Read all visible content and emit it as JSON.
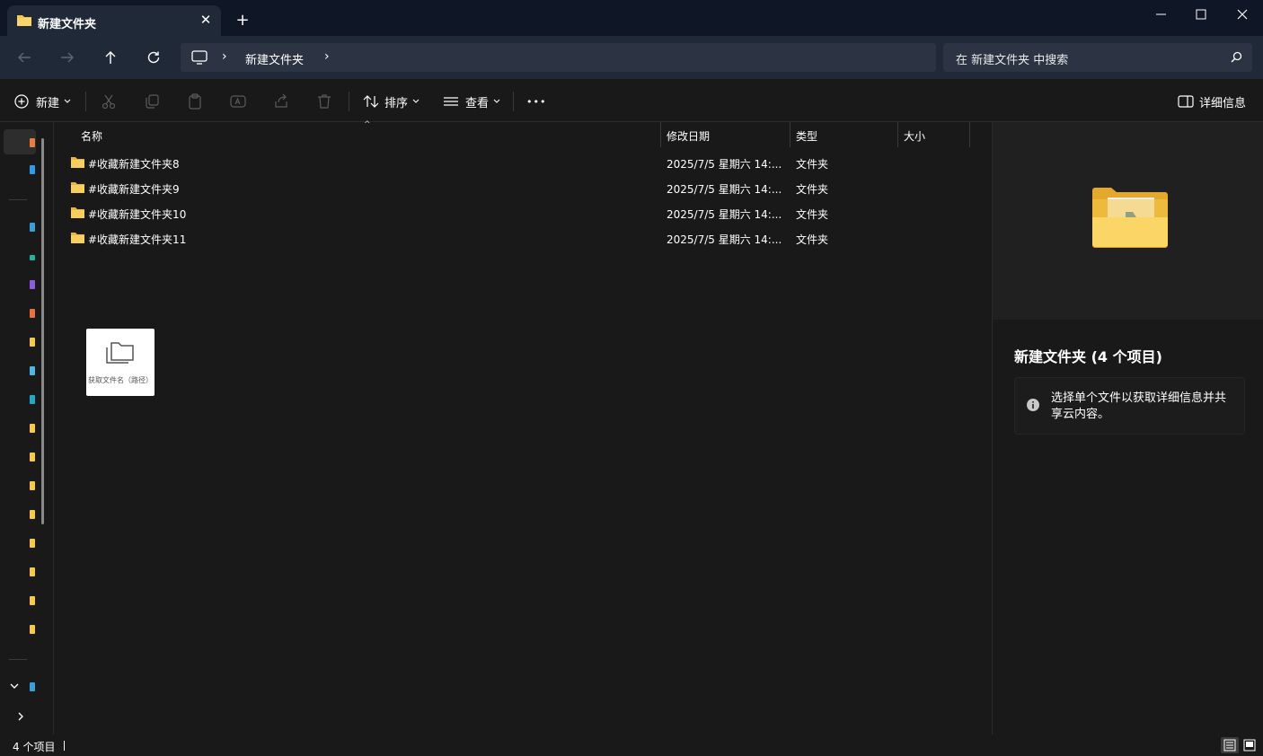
{
  "titlebar": {
    "tab_title": "新建文件夹",
    "tab_close": "✕",
    "new_tab": "+",
    "minimize": "—",
    "maximize": "☐",
    "close": "✕"
  },
  "navbar": {
    "breadcrumb_sep": "›",
    "breadcrumb_current": "新建文件夹",
    "search_placeholder": "在 新建文件夹 中搜索"
  },
  "commandbar": {
    "new_label": "新建",
    "sort_label": "排序",
    "view_label": "查看",
    "more_label": "•••",
    "details_label": "详细信息"
  },
  "columns": {
    "name": "名称",
    "modified": "修改日期",
    "type": "类型",
    "size": "大小"
  },
  "files": [
    {
      "name": "#收藏新建文件夹8",
      "date": "2025/7/5 星期六  14:...",
      "type": "文件夹"
    },
    {
      "name": "#收藏新建文件夹9",
      "date": "2025/7/5 星期六  14:...",
      "type": "文件夹"
    },
    {
      "name": "#收藏新建文件夹10",
      "date": "2025/7/5 星期六  14:...",
      "type": "文件夹"
    },
    {
      "name": "#收藏新建文件夹11",
      "date": "2025/7/5 星期六  14:...",
      "type": "文件夹"
    }
  ],
  "popup": {
    "label": "获取文件名（路径）"
  },
  "details_pane": {
    "title": "新建文件夹 (4 个项目)",
    "info_text": "选择单个文件以获取详细信息并共享云内容。"
  },
  "statusbar": {
    "item_count": "4 个项目"
  },
  "colors": {
    "accent_folder": "#f6c94c",
    "background": "#191919",
    "header_bg": "#202938"
  }
}
